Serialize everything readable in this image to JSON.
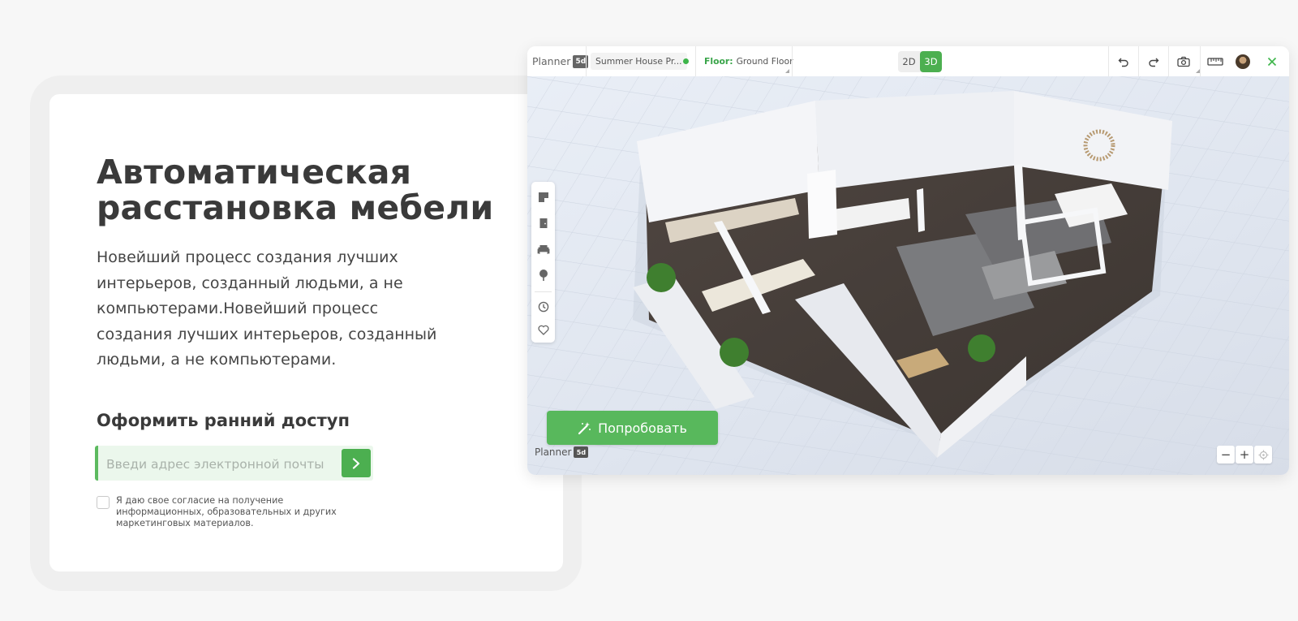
{
  "promo": {
    "headline": "Автоматическая расстановка мебели",
    "description": "Новейший процесс создания лучших интерьеров, созданный людьми, а не компьютерами.Новейший процесс создания лучших интерьеров, созданный людьми, а не компьютерами.",
    "early_access_title": "Оформить ранний доступ",
    "email_placeholder": "Введи адрес электронной почты",
    "consent_text": "Я даю свое согласие на получение информационных, образовательных и других маркетинговых материалов."
  },
  "app": {
    "logo_text": "Planner",
    "logo_mark": "5d",
    "project_name": "Summer House Pr...",
    "floor_label": "Floor:",
    "floor_value": "Ground Floor",
    "view_2d": "2D",
    "view_3d": "3D",
    "active_view": "3D",
    "try_button_label": "Попробовать",
    "watermark_text": "Planner",
    "watermark_mark": "5d",
    "zoom_out": "−",
    "zoom_in": "+",
    "icons": {
      "toolbar": [
        "undo-icon",
        "redo-icon",
        "camera-icon",
        "ruler-icon",
        "avatar",
        "close-icon"
      ],
      "left_tools": [
        "floor-plan-icon",
        "door-icon",
        "furniture-icon",
        "plant-icon",
        "history-icon",
        "favorite-icon"
      ]
    }
  },
  "colors": {
    "accent_green": "#4caf50",
    "status_green": "#3db54a",
    "input_bg": "#ebf7ec"
  }
}
